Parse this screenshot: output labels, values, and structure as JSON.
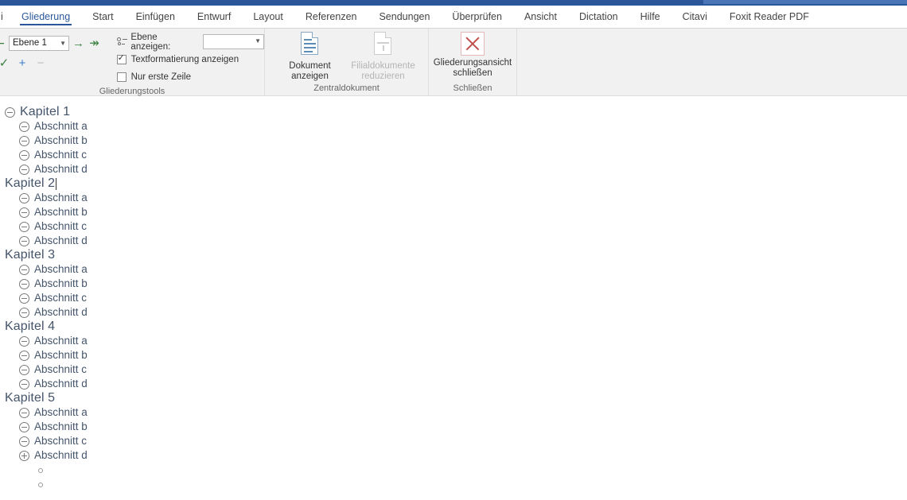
{
  "window": {
    "titlebar_color": "#2b579a",
    "titlebar_highlight_color": "#4a76b8"
  },
  "tabs": {
    "clipped_left_label": "i",
    "items": [
      {
        "label": "Gliederung",
        "active": true
      },
      {
        "label": "Start",
        "active": false
      },
      {
        "label": "Einfügen",
        "active": false
      },
      {
        "label": "Entwurf",
        "active": false
      },
      {
        "label": "Layout",
        "active": false
      },
      {
        "label": "Referenzen",
        "active": false
      },
      {
        "label": "Sendungen",
        "active": false
      },
      {
        "label": "Überprüfen",
        "active": false
      },
      {
        "label": "Ansicht",
        "active": false
      },
      {
        "label": "Dictation",
        "active": false
      },
      {
        "label": "Hilfe",
        "active": false
      },
      {
        "label": "Citavi",
        "active": false
      },
      {
        "label": "Foxit Reader PDF",
        "active": false
      }
    ]
  },
  "ribbon": {
    "groups": {
      "outline_tools": {
        "label": "Gliederungstools",
        "level_select_value": "Ebene 1",
        "promote_icon": "promote-arrow-icon",
        "demote_icon": "demote-arrow-icon",
        "demote_to_body_icon": "demote-to-body-icon",
        "move_up_icon": "move-up-icon",
        "expand_icon": "+",
        "collapse_icon": "−",
        "show_level_label": "Ebene anzeigen:",
        "show_level_value": "",
        "show_text_formatting": {
          "label": "Textformatierung anzeigen",
          "checked": true
        },
        "first_line_only": {
          "label": "Nur erste Zeile",
          "checked": false
        }
      },
      "master_document": {
        "label": "Zentraldokument",
        "show_document": {
          "line1": "Dokument",
          "line2": "anzeigen",
          "disabled": false
        },
        "collapse_subdocuments": {
          "line1": "Filialdokumente",
          "line2": "reduzieren",
          "disabled": true
        }
      },
      "close": {
        "label": "Schließen",
        "close_outline_view": {
          "line1": "Gliederungsansicht",
          "line2": "schließen"
        }
      }
    }
  },
  "document": {
    "heading_color": "#44546a",
    "caret_after": "Kapitel 2",
    "outline": [
      {
        "level": 1,
        "text": "Kapitel 1",
        "marker": "collapse-minus-icon",
        "has_caret": false
      },
      {
        "level": 2,
        "text": "Abschnitt a",
        "marker": "collapse-minus-icon",
        "has_caret": false
      },
      {
        "level": 2,
        "text": "Abschnitt b",
        "marker": "collapse-minus-icon",
        "has_caret": false
      },
      {
        "level": 2,
        "text": "Abschnitt c",
        "marker": "collapse-minus-icon",
        "has_caret": false
      },
      {
        "level": 2,
        "text": "Abschnitt d",
        "marker": "collapse-minus-icon",
        "has_caret": false
      },
      {
        "level": 1,
        "text": "Kapitel 2",
        "marker": "none",
        "has_caret": true
      },
      {
        "level": 2,
        "text": "Abschnitt a",
        "marker": "collapse-minus-icon",
        "has_caret": false
      },
      {
        "level": 2,
        "text": "Abschnitt b",
        "marker": "collapse-minus-icon",
        "has_caret": false
      },
      {
        "level": 2,
        "text": "Abschnitt c",
        "marker": "collapse-minus-icon",
        "has_caret": false
      },
      {
        "level": 2,
        "text": "Abschnitt d",
        "marker": "collapse-minus-icon",
        "has_caret": false
      },
      {
        "level": 1,
        "text": "Kapitel 3",
        "marker": "none",
        "has_caret": false
      },
      {
        "level": 2,
        "text": "Abschnitt a",
        "marker": "collapse-minus-icon",
        "has_caret": false
      },
      {
        "level": 2,
        "text": "Abschnitt b",
        "marker": "collapse-minus-icon",
        "has_caret": false
      },
      {
        "level": 2,
        "text": "Abschnitt c",
        "marker": "collapse-minus-icon",
        "has_caret": false
      },
      {
        "level": 2,
        "text": "Abschnitt d",
        "marker": "collapse-minus-icon",
        "has_caret": false
      },
      {
        "level": 1,
        "text": "Kapitel 4",
        "marker": "none",
        "has_caret": false
      },
      {
        "level": 2,
        "text": "Abschnitt a",
        "marker": "collapse-minus-icon",
        "has_caret": false
      },
      {
        "level": 2,
        "text": "Abschnitt b",
        "marker": "collapse-minus-icon",
        "has_caret": false
      },
      {
        "level": 2,
        "text": "Abschnitt c",
        "marker": "collapse-minus-icon",
        "has_caret": false
      },
      {
        "level": 2,
        "text": "Abschnitt d",
        "marker": "collapse-minus-icon",
        "has_caret": false
      },
      {
        "level": 1,
        "text": "Kapitel 5",
        "marker": "none",
        "has_caret": false
      },
      {
        "level": 2,
        "text": "Abschnitt a",
        "marker": "collapse-minus-icon",
        "has_caret": false
      },
      {
        "level": 2,
        "text": "Abschnitt b",
        "marker": "collapse-minus-icon",
        "has_caret": false
      },
      {
        "level": 2,
        "text": "Abschnitt c",
        "marker": "collapse-minus-icon",
        "has_caret": false
      },
      {
        "level": 2,
        "text": "Abschnitt d",
        "marker": "expand-plus-icon",
        "has_caret": false
      },
      {
        "level": 3,
        "text": "",
        "marker": "body-text-dot-icon",
        "has_caret": false
      },
      {
        "level": 3,
        "text": "",
        "marker": "body-text-dot-icon",
        "has_caret": false
      }
    ]
  }
}
